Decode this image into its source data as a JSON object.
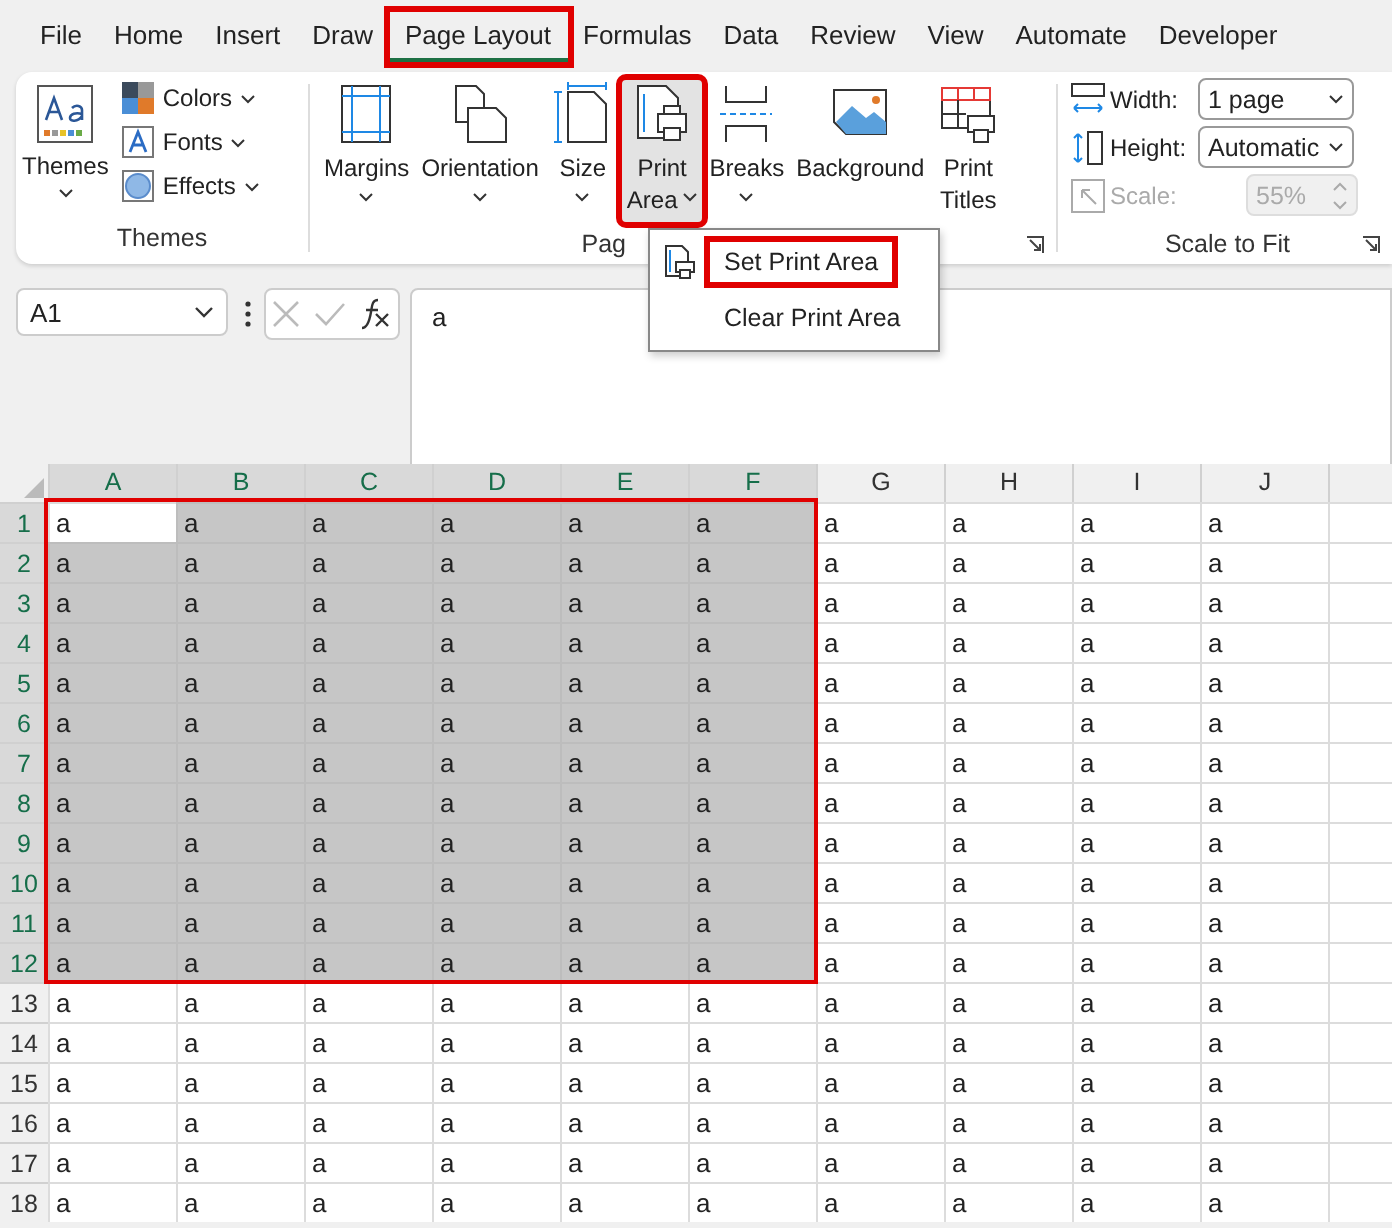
{
  "tabs": [
    {
      "label": "File",
      "selected": false,
      "highlighted": false
    },
    {
      "label": "Home",
      "selected": false,
      "highlighted": false
    },
    {
      "label": "Insert",
      "selected": false,
      "highlighted": false
    },
    {
      "label": "Draw",
      "selected": false,
      "highlighted": false
    },
    {
      "label": "Page Layout",
      "selected": true,
      "highlighted": true
    },
    {
      "label": "Formulas",
      "selected": false,
      "highlighted": false
    },
    {
      "label": "Data",
      "selected": false,
      "highlighted": false
    },
    {
      "label": "Review",
      "selected": false,
      "highlighted": false
    },
    {
      "label": "View",
      "selected": false,
      "highlighted": false
    },
    {
      "label": "Automate",
      "selected": false,
      "highlighted": false
    },
    {
      "label": "Developer",
      "selected": false,
      "highlighted": false
    }
  ],
  "themes_group": {
    "label": "Themes",
    "big_button": {
      "label": "Themes"
    },
    "small_buttons": [
      {
        "label": "Colors",
        "kind": "colors"
      },
      {
        "label": "Fonts",
        "kind": "fonts"
      },
      {
        "label": "Effects",
        "kind": "effects"
      }
    ]
  },
  "page_setup_group": {
    "label": "Pag",
    "buttons": [
      {
        "lines": [
          "Margins"
        ],
        "kind": "margins",
        "dropdown": true,
        "highlighted": false
      },
      {
        "lines": [
          "Orientation"
        ],
        "kind": "orientation",
        "dropdown": true,
        "highlighted": false
      },
      {
        "lines": [
          "Size"
        ],
        "kind": "size",
        "dropdown": true,
        "highlighted": false
      },
      {
        "lines": [
          "Print",
          "Area"
        ],
        "kind": "print_area",
        "dropdown": true,
        "highlighted": true
      },
      {
        "lines": [
          "Breaks"
        ],
        "kind": "breaks",
        "dropdown": true,
        "highlighted": false
      },
      {
        "lines": [
          "Background"
        ],
        "kind": "background",
        "dropdown": false,
        "highlighted": false
      },
      {
        "lines": [
          "Print",
          "Titles"
        ],
        "kind": "print_titles",
        "dropdown": false,
        "highlighted": false
      }
    ]
  },
  "scale_group": {
    "label": "Scale to Fit",
    "fields": [
      {
        "label": "Width:",
        "value": "1 page",
        "kind": "dropdown",
        "disabled": false
      },
      {
        "label": "Height:",
        "value": "Automatic",
        "kind": "dropdown",
        "disabled": false
      },
      {
        "label": "Scale:",
        "value": "55%",
        "kind": "spinner",
        "disabled": true
      }
    ]
  },
  "print_area_menu": {
    "items": [
      {
        "label": "Set Print Area",
        "highlighted": true,
        "icon": true
      },
      {
        "label": "Clear Print Area",
        "highlighted": false,
        "icon": false
      }
    ]
  },
  "formula_bar": {
    "name_box": "A1",
    "content": "a"
  },
  "sheet": {
    "print_area_marked": true,
    "columns": [
      {
        "label": "A",
        "selected": true
      },
      {
        "label": "B",
        "selected": true
      },
      {
        "label": "C",
        "selected": true
      },
      {
        "label": "D",
        "selected": true
      },
      {
        "label": "E",
        "selected": true
      },
      {
        "label": "F",
        "selected": true
      },
      {
        "label": "G",
        "selected": false
      },
      {
        "label": "H",
        "selected": false
      },
      {
        "label": "I",
        "selected": false
      },
      {
        "label": "J",
        "selected": false
      }
    ],
    "rows": [
      {
        "label": "1",
        "selected": true,
        "cells": [
          "a",
          "a",
          "a",
          "a",
          "a",
          "a",
          "a",
          "a",
          "a",
          "a"
        ]
      },
      {
        "label": "2",
        "selected": true,
        "cells": [
          "a",
          "a",
          "a",
          "a",
          "a",
          "a",
          "a",
          "a",
          "a",
          "a"
        ]
      },
      {
        "label": "3",
        "selected": true,
        "cells": [
          "a",
          "a",
          "a",
          "a",
          "a",
          "a",
          "a",
          "a",
          "a",
          "a"
        ]
      },
      {
        "label": "4",
        "selected": true,
        "cells": [
          "a",
          "a",
          "a",
          "a",
          "a",
          "a",
          "a",
          "a",
          "a",
          "a"
        ]
      },
      {
        "label": "5",
        "selected": true,
        "cells": [
          "a",
          "a",
          "a",
          "a",
          "a",
          "a",
          "a",
          "a",
          "a",
          "a"
        ]
      },
      {
        "label": "6",
        "selected": true,
        "cells": [
          "a",
          "a",
          "a",
          "a",
          "a",
          "a",
          "a",
          "a",
          "a",
          "a"
        ]
      },
      {
        "label": "7",
        "selected": true,
        "cells": [
          "a",
          "a",
          "a",
          "a",
          "a",
          "a",
          "a",
          "a",
          "a",
          "a"
        ]
      },
      {
        "label": "8",
        "selected": true,
        "cells": [
          "a",
          "a",
          "a",
          "a",
          "a",
          "a",
          "a",
          "a",
          "a",
          "a"
        ]
      },
      {
        "label": "9",
        "selected": true,
        "cells": [
          "a",
          "a",
          "a",
          "a",
          "a",
          "a",
          "a",
          "a",
          "a",
          "a"
        ]
      },
      {
        "label": "10",
        "selected": true,
        "cells": [
          "a",
          "a",
          "a",
          "a",
          "a",
          "a",
          "a",
          "a",
          "a",
          "a"
        ]
      },
      {
        "label": "11",
        "selected": true,
        "cells": [
          "a",
          "a",
          "a",
          "a",
          "a",
          "a",
          "a",
          "a",
          "a",
          "a"
        ]
      },
      {
        "label": "12",
        "selected": true,
        "cells": [
          "a",
          "a",
          "a",
          "a",
          "a",
          "a",
          "a",
          "a",
          "a",
          "a"
        ]
      },
      {
        "label": "13",
        "selected": false,
        "cells": [
          "a",
          "a",
          "a",
          "a",
          "a",
          "a",
          "a",
          "a",
          "a",
          "a"
        ]
      },
      {
        "label": "14",
        "selected": false,
        "cells": [
          "a",
          "a",
          "a",
          "a",
          "a",
          "a",
          "a",
          "a",
          "a",
          "a"
        ]
      },
      {
        "label": "15",
        "selected": false,
        "cells": [
          "a",
          "a",
          "a",
          "a",
          "a",
          "a",
          "a",
          "a",
          "a",
          "a"
        ]
      },
      {
        "label": "16",
        "selected": false,
        "cells": [
          "a",
          "a",
          "a",
          "a",
          "a",
          "a",
          "a",
          "a",
          "a",
          "a"
        ]
      },
      {
        "label": "17",
        "selected": false,
        "cells": [
          "a",
          "a",
          "a",
          "a",
          "a",
          "a",
          "a",
          "a",
          "a",
          "a"
        ]
      },
      {
        "label": "18",
        "selected": false,
        "cells": [
          "a",
          "a",
          "a",
          "a",
          "a",
          "a",
          "a",
          "a",
          "a",
          "a"
        ]
      }
    ]
  }
}
